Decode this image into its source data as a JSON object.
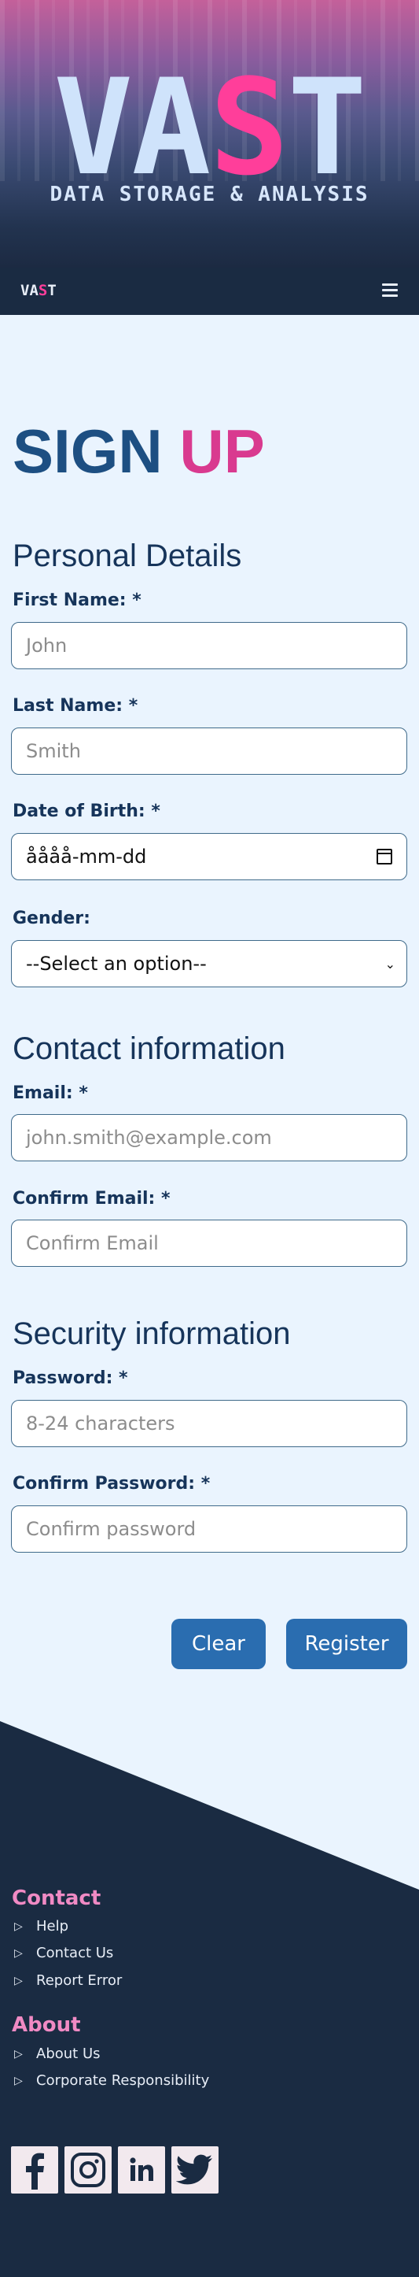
{
  "banner": {
    "logo_part1": "VA",
    "logo_part2": "S",
    "logo_part3": "T",
    "tagline": "DATA STORAGE & ANALYSIS"
  },
  "nav": {
    "logo_part1": "VA",
    "logo_part2": "S",
    "logo_part3": "T",
    "menu_icon": "hamburger-icon"
  },
  "page": {
    "title_part1": "SIGN",
    "title_part2": "UP"
  },
  "personal": {
    "heading": "Personal Details",
    "first_name_label": "First Name: *",
    "first_name_placeholder": "John",
    "last_name_label": "Last Name: *",
    "last_name_placeholder": "Smith",
    "dob_label": "Date of Birth: *",
    "dob_value": "åååå-mm-dd",
    "gender_label": "Gender:",
    "gender_selected": "--Select an option--"
  },
  "contact": {
    "heading": "Contact information",
    "email_label": "Email: *",
    "email_placeholder": "john.smith@example.com",
    "confirm_email_label": "Confirm Email: *",
    "confirm_email_placeholder": "Confirm Email"
  },
  "security": {
    "heading": "Security information",
    "password_label": "Password: *",
    "password_placeholder": "8-24 characters",
    "confirm_password_label": "Confirm Password: *",
    "confirm_password_placeholder": "Confirm password"
  },
  "buttons": {
    "clear": "Clear",
    "register": "Register"
  },
  "footer": {
    "contact_heading": "Contact",
    "contact_items": [
      "Help",
      "Contact Us",
      "Report Error"
    ],
    "about_heading": "About",
    "about_items": [
      "About Us",
      "Corporate Responsibility"
    ],
    "social_icons": [
      "facebook-icon",
      "instagram-icon",
      "linkedin-icon",
      "twitter-icon"
    ]
  },
  "colors": {
    "accent_pink": "#ff3e9a",
    "button_blue": "#2a6db0",
    "dark_navy": "#1a2b42",
    "page_bg": "#eaf4fe"
  }
}
